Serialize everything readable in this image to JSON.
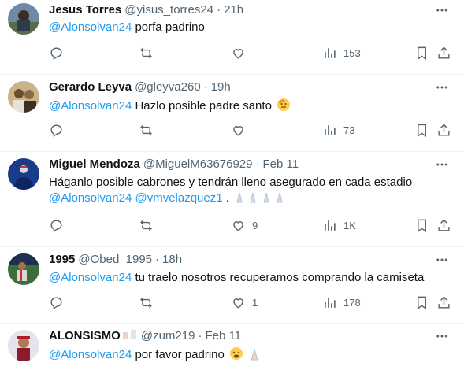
{
  "tweets": [
    {
      "name": "Jesus Torres",
      "handle": "@yisus_torres24",
      "separator": "·",
      "time": "21h",
      "mention": "@Alonsolvan24",
      "text": " porfa padrino",
      "replies": "",
      "retweets": "",
      "likes": "",
      "views": "153"
    },
    {
      "name": "Gerardo Leyva",
      "handle": "@gleyva260",
      "separator": "·",
      "time": "19h",
      "mention": "@Alonsolvan24",
      "text": " Hazlo posible padre santo",
      "replies": "",
      "retweets": "",
      "likes": "",
      "views": "73"
    },
    {
      "name": "Miguel Mendoza",
      "handle": "@MiguelM63676929",
      "separator": "·",
      "time": "Feb 11",
      "line1": "Háganlo posible cabrones y tendrán lleno asegurado en cada estadio",
      "mention": "@Alonsolvan24",
      "mention2": "@vmvelazquez1",
      "text": " . ",
      "replies": "",
      "retweets": "",
      "likes": "9",
      "views": "1K"
    },
    {
      "name": "1995",
      "handle": "@Obed_1995",
      "separator": "·",
      "time": "18h",
      "mention": "@Alonsolvan24",
      "text": " tu traelo nosotros recuperamos comprando la camiseta",
      "replies": "",
      "retweets": "",
      "likes": "1",
      "views": "178"
    },
    {
      "name": "ALONSISMO",
      "handle": "@zum219",
      "separator": "·",
      "time": "Feb 11",
      "mention": "@Alonsolvan24",
      "text": " por favor padrino ",
      "replies": "",
      "retweets": "",
      "likes": "",
      "views": ""
    }
  ],
  "colors": {
    "accent": "#1d9bf0",
    "text": "#0f1419",
    "secondary": "#536471",
    "divider": "#eff3f4"
  },
  "icons": [
    "reply-icon",
    "retweet-icon",
    "like-icon",
    "views-icon",
    "bookmark-icon",
    "share-icon",
    "more-icon"
  ]
}
